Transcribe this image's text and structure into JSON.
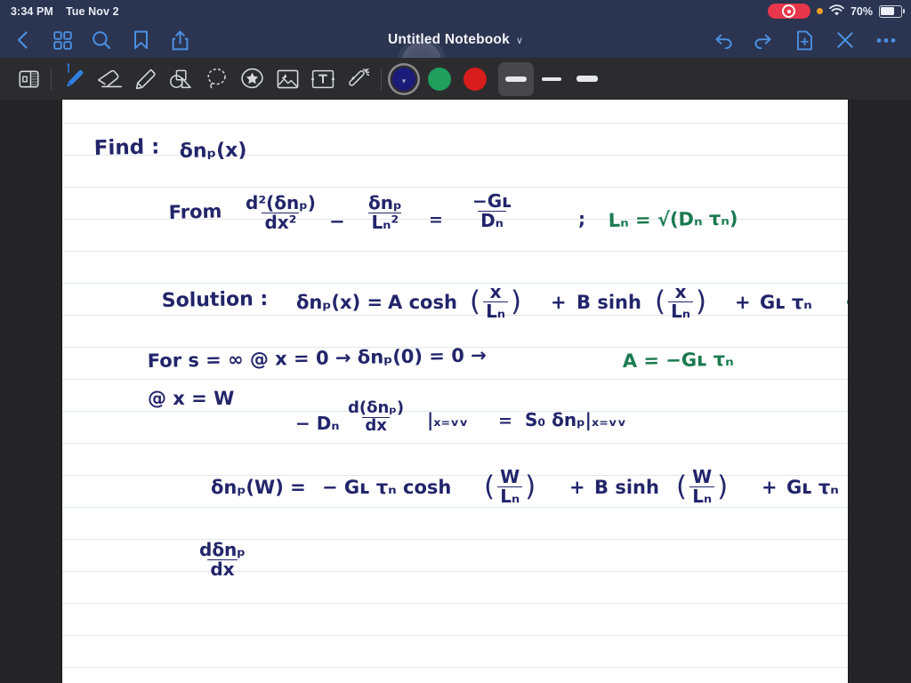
{
  "statusbar": {
    "time": "3:34 PM",
    "date": "Tue Nov 2",
    "battery_pct": "70%",
    "recording_icon": "screen-record-icon",
    "privacy_dot_icon": "orange-privacy-dot-icon",
    "wifi_icon": "wifi-icon",
    "battery_icon": "battery-icon",
    "bar_color": "#2b3450"
  },
  "navbar": {
    "title": "Untitled Notebook",
    "title_chevron": "∨",
    "accent_color": "#4a90e2",
    "left_items": [
      {
        "name": "back-button",
        "icon": "chevron-left-icon"
      },
      {
        "name": "page-grid-button",
        "icon": "grid-icon"
      },
      {
        "name": "search-button",
        "icon": "search-icon"
      },
      {
        "name": "bookmark-button",
        "icon": "bookmark-icon"
      },
      {
        "name": "share-button",
        "icon": "share-icon"
      }
    ],
    "right_items": [
      {
        "name": "undo-button",
        "icon": "undo-icon"
      },
      {
        "name": "redo-button",
        "icon": "redo-icon"
      },
      {
        "name": "new-page-button",
        "icon": "document-plus-icon"
      },
      {
        "name": "close-button",
        "icon": "close-x-icon"
      },
      {
        "name": "more-button",
        "icon": "ellipsis-icon"
      }
    ]
  },
  "toolbar": {
    "background": "#2c2c2e",
    "tools": [
      {
        "name": "sidebar-toggle",
        "icon": "sidebar-panel-icon",
        "active": false
      },
      {
        "name": "pen-tool",
        "icon": "pen-icon",
        "active": true
      },
      {
        "name": "eraser-tool",
        "icon": "eraser-icon",
        "active": false
      },
      {
        "name": "highlighter-tool",
        "icon": "highlighter-icon",
        "active": false
      },
      {
        "name": "shapes-tool",
        "icon": "shapes-icon",
        "active": false
      },
      {
        "name": "lasso-tool",
        "icon": "lasso-icon",
        "active": false
      },
      {
        "name": "sticker-tool",
        "icon": "sticker-star-icon",
        "active": false
      },
      {
        "name": "image-tool",
        "icon": "image-icon",
        "active": false
      },
      {
        "name": "text-box-tool",
        "icon": "text-box-icon",
        "active": false
      },
      {
        "name": "laser-pointer-tool",
        "icon": "laser-pointer-icon",
        "active": false
      }
    ],
    "colors": [
      {
        "name": "color-swatch-navy",
        "hex": "#1b1b7a",
        "selected": true
      },
      {
        "name": "color-swatch-green",
        "hex": "#1f9e5e",
        "selected": false
      },
      {
        "name": "color-swatch-red",
        "hex": "#d81d1d",
        "selected": false
      }
    ],
    "thickness": [
      {
        "name": "thickness-thick",
        "selected": true
      },
      {
        "name": "thickness-medium",
        "selected": false
      },
      {
        "name": "thickness-thin",
        "selected": false
      }
    ]
  },
  "page": {
    "background": "#ffffff",
    "rule_color": "#e3e6ea",
    "ink_color": "#23256b",
    "accent_ink_color": "#1a7a4f",
    "notes": {
      "find_label": "Find :",
      "find_target": "δnₚ(x)",
      "from_label": "From",
      "eq_numer_1": "d²(δnₚ)",
      "eq_denom_1": "dx²",
      "minus": "−",
      "eq_numer_2": "δnₚ",
      "eq_denom_2": "Lₙ²",
      "equals": "=",
      "eq_numer_3": "−Gʟ",
      "eq_denom_3": "Dₙ",
      "semicolon": ";",
      "diffusion_length": "Lₙ = √(Dₙ τₙ)",
      "solution_label": "Solution :",
      "solution_lhs": "δnₚ(x) =",
      "solution_term1": "A cosh",
      "solution_arg1_num": "x",
      "solution_arg1_den": "Lₙ",
      "plus": "+",
      "solution_term2": "B sinh",
      "solution_arg2_num": "x",
      "solution_arg2_den": "Lₙ",
      "solution_term3": "Gʟ τₙ",
      "check_mark": "✓",
      "bc1": "For s = ∞  @ x = 0  →   δnₚ(0) = 0   →",
      "bc1_result": "A = −Gʟ τₙ",
      "bc2_label": "@ x = W",
      "bc2_lhs_prefix": "− Dₙ",
      "bc2_num": "d(δnₚ)",
      "bc2_den": "dx",
      "bc2_eval1": "|ₓ₌ᵥᵥ",
      "bc2_eq": "=",
      "bc2_rhs": "S₀ δnₚ|ₓ₌ᵥᵥ",
      "w_lhs": "δnₚ(W) =",
      "w_term1": "− Gʟ τₙ cosh",
      "w_arg1_num": "W",
      "w_arg1_den": "Lₙ",
      "w_term2": "B sinh",
      "w_arg2_num": "W",
      "w_arg2_den": "Lₙ",
      "w_term3": "Gʟ τₙ",
      "deriv_num": "dδnₚ",
      "deriv_den": "dx"
    }
  }
}
